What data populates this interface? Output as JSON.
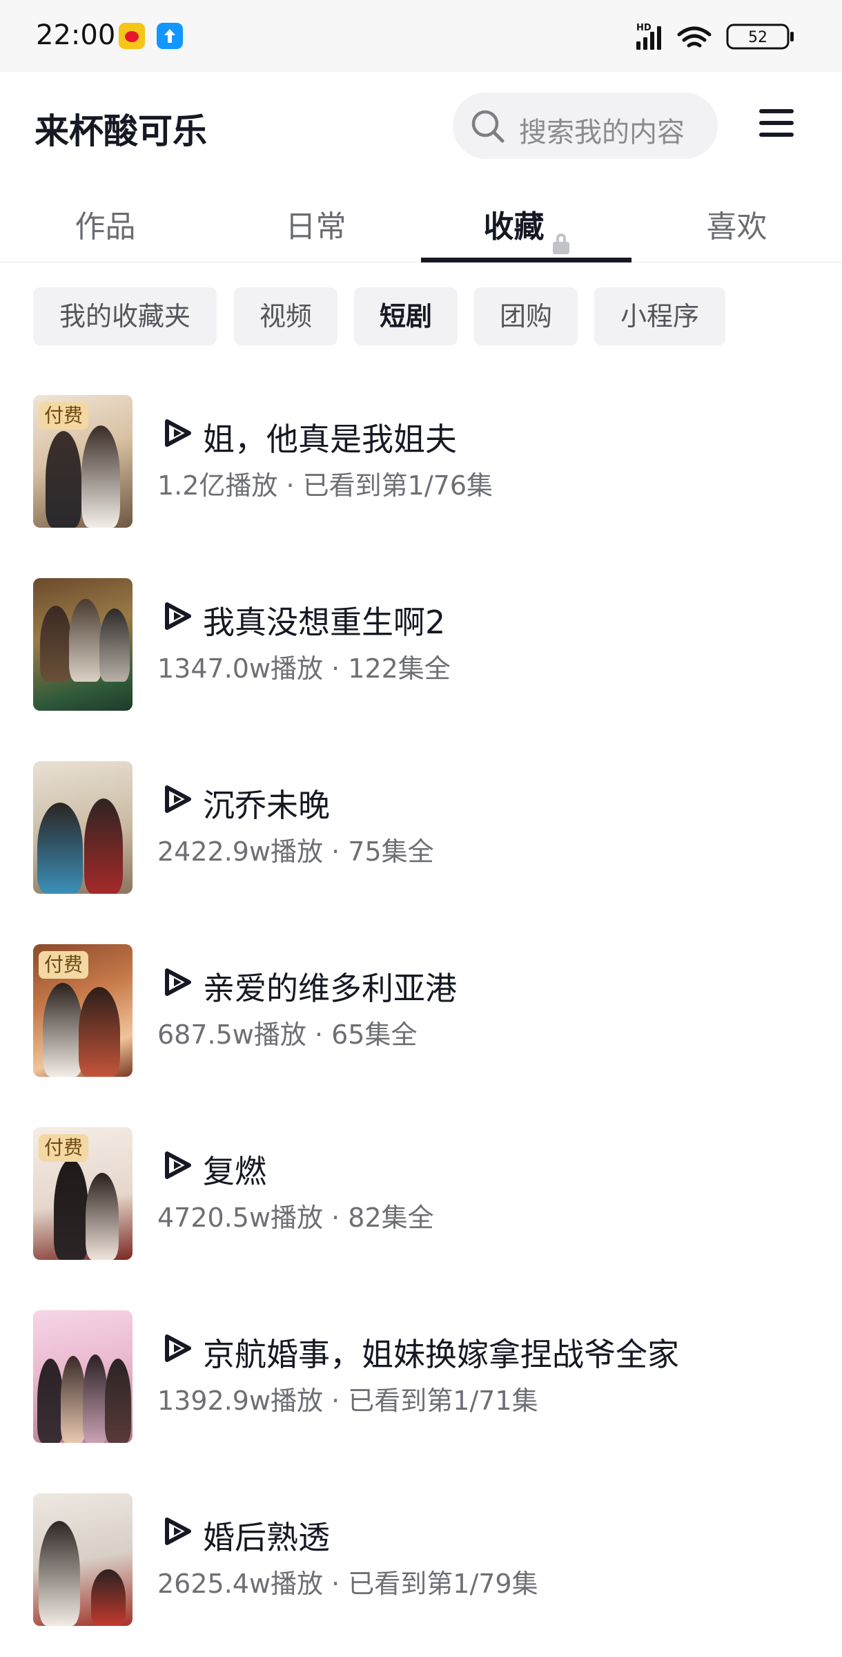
{
  "status_bar": {
    "time": "22:00",
    "battery": "52",
    "network": "HD"
  },
  "header": {
    "profile_name": "来杯酸可乐",
    "search_placeholder": "搜索我的内容"
  },
  "tabs": [
    {
      "label": "作品",
      "active": false
    },
    {
      "label": "日常",
      "active": false
    },
    {
      "label": "收藏",
      "active": true,
      "locked": true
    },
    {
      "label": "喜欢",
      "active": false
    }
  ],
  "filters": [
    {
      "label": "我的收藏夹",
      "active": false
    },
    {
      "label": "视频",
      "active": false
    },
    {
      "label": "短剧",
      "active": true
    },
    {
      "label": "团购",
      "active": false
    },
    {
      "label": "小程序",
      "active": false
    }
  ],
  "dramas": [
    {
      "title": "姐，他真是我姐夫",
      "meta": "1.2亿播放 · 已看到第1/76集",
      "badge": "付费"
    },
    {
      "title": "我真没想重生啊2",
      "meta": "1347.0w播放 · 122集全",
      "badge": ""
    },
    {
      "title": "沉乔未晚",
      "meta": "2422.9w播放 · 75集全",
      "badge": ""
    },
    {
      "title": "亲爱的维多利亚港",
      "meta": "687.5w播放 · 65集全",
      "badge": "付费"
    },
    {
      "title": "复燃",
      "meta": "4720.5w播放 · 82集全",
      "badge": "付费"
    },
    {
      "title": "京航婚事，姐妹换嫁拿捏战爷全家",
      "meta": "1392.9w播放 · 已看到第1/71集",
      "badge": ""
    },
    {
      "title": "婚后熟透",
      "meta": "2625.4w播放 · 已看到第1/79集",
      "badge": ""
    }
  ],
  "colors": {
    "text_primary": "#161823",
    "text_secondary": "#6e6f75",
    "chip_bg": "#f2f2f4",
    "badge_bg": "#f3d8a3"
  }
}
